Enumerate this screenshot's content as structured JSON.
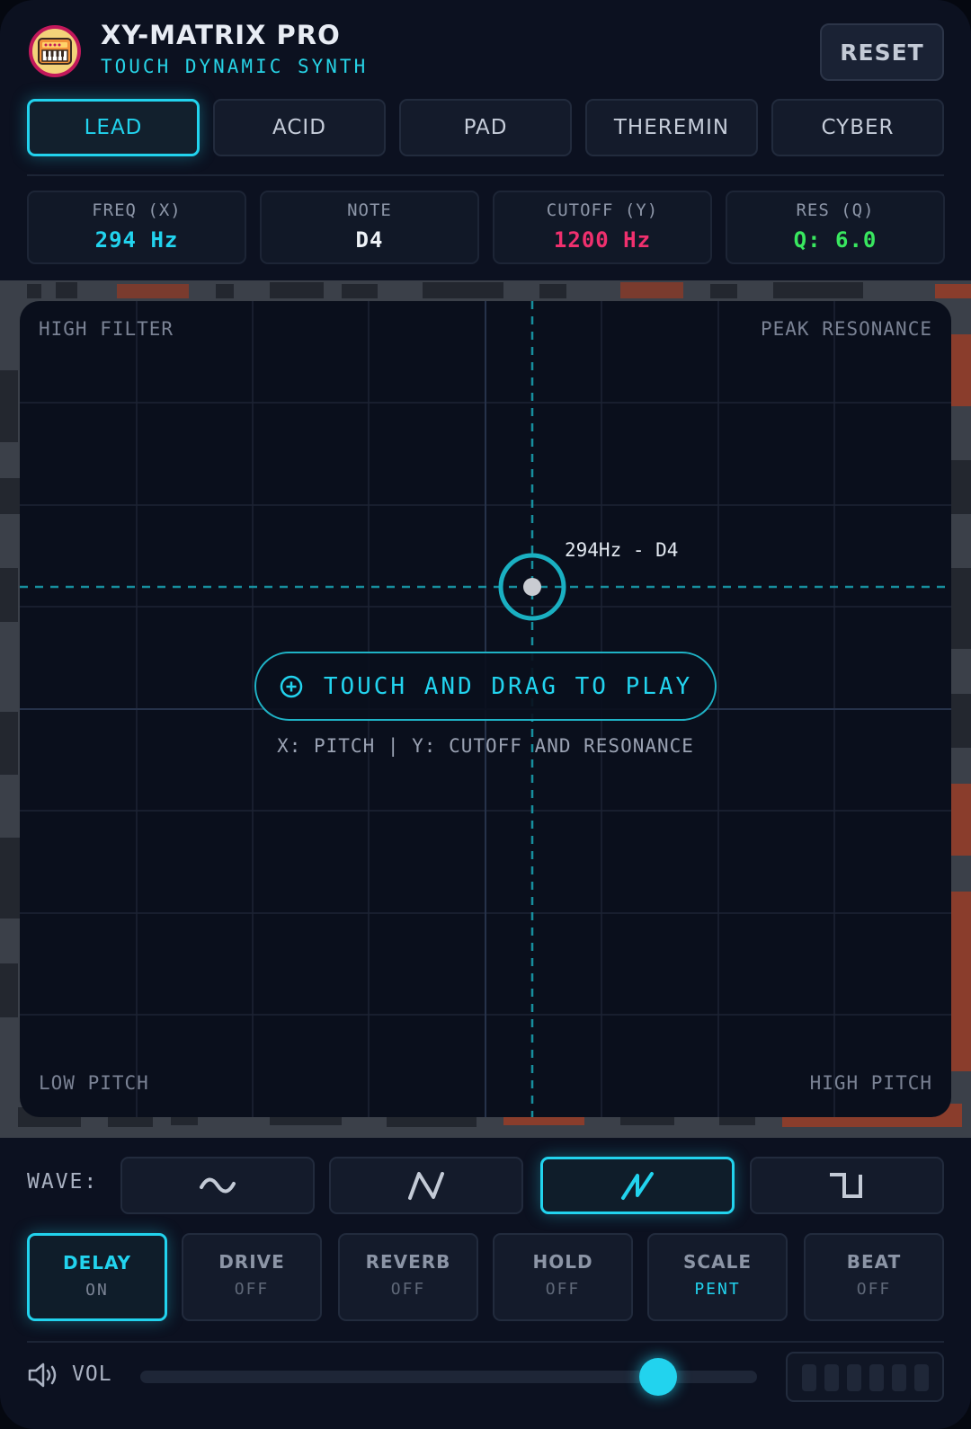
{
  "header": {
    "title": "XY-MATRIX PRO",
    "subtitle": "TOUCH DYNAMIC SYNTH",
    "reset_label": "RESET"
  },
  "presets": [
    {
      "label": "LEAD",
      "active": true
    },
    {
      "label": "ACID",
      "active": false
    },
    {
      "label": "PAD",
      "active": false
    },
    {
      "label": "THEREMIN",
      "active": false
    },
    {
      "label": "CYBER",
      "active": false
    }
  ],
  "readouts": [
    {
      "label": "FREQ (X)",
      "value": "294 Hz",
      "color": "#22d3ee"
    },
    {
      "label": "NOTE",
      "value": "D4",
      "color": "#eef2f7"
    },
    {
      "label": "CUTOFF (Y)",
      "value": "1200 Hz",
      "color": "#f0306e"
    },
    {
      "label": "RES (Q)",
      "value": "Q: 6.0",
      "color": "#39e75f"
    }
  ],
  "pad": {
    "top_left": "HIGH FILTER",
    "top_right": "PEAK RESONANCE",
    "bottom_left": "LOW PITCH",
    "bottom_right": "HIGH PITCH",
    "cursor_label": "294Hz - D4",
    "touch_prompt": "TOUCH AND DRAG TO PLAY",
    "axes_hint": "X: PITCH | Y: CUTOFF AND RESONANCE"
  },
  "wave": {
    "label": "WAVE:",
    "options": [
      {
        "icon": "sine-wave-icon",
        "active": false
      },
      {
        "icon": "triangle-wave-icon",
        "active": false
      },
      {
        "icon": "sawtooth-wave-icon",
        "active": true
      },
      {
        "icon": "square-wave-icon",
        "active": false
      }
    ]
  },
  "effects": [
    {
      "name": "DELAY",
      "state": "ON",
      "active": true
    },
    {
      "name": "DRIVE",
      "state": "OFF",
      "active": false
    },
    {
      "name": "REVERB",
      "state": "OFF",
      "active": false
    },
    {
      "name": "HOLD",
      "state": "OFF",
      "active": false
    },
    {
      "name": "SCALE",
      "state": "PENT",
      "active": false
    },
    {
      "name": "BEAT",
      "state": "OFF",
      "active": false
    }
  ],
  "volume": {
    "label": "VOL",
    "icon": "speaker-icon",
    "level": 0.84
  },
  "colors": {
    "accent": "#22d3ee",
    "background": "#0c1120",
    "cutoff": "#f0306e",
    "resonance": "#39e75f"
  }
}
